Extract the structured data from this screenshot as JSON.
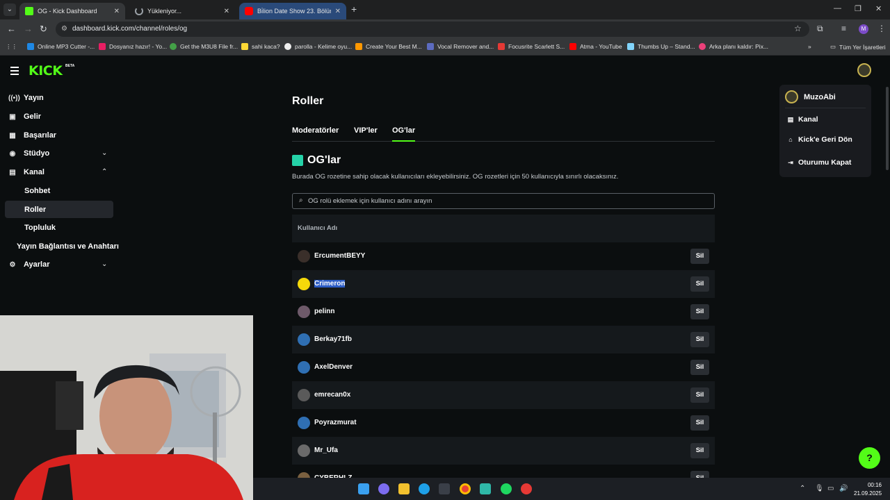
{
  "browser": {
    "tabs": [
      {
        "title": "OG - Kick Dashboard",
        "favicon_color": "#53fc18"
      },
      {
        "title": "Yükleniyor...",
        "favicon_color": "#5f6368"
      },
      {
        "title": "Bi̇lion Date Show 23. Bölüm - Y",
        "favicon_color": "#ff0000"
      }
    ],
    "url": "dashboard.kick.com/channel/roles/og",
    "profile_initial": "M",
    "bookmarks": [
      {
        "label": "Online MP3 Cutter -...",
        "color": "#1e88e5"
      },
      {
        "label": "Dosyanız hazır! - Yo...",
        "color": "#e91e63"
      },
      {
        "label": "Get the M3U8 File fr...",
        "color": "#43a047"
      },
      {
        "label": "sahi kaca?",
        "color": "#fdd835"
      },
      {
        "label": "parolla - Kelime oyu...",
        "color": "#eeeeee"
      },
      {
        "label": "Create Your Best M...",
        "color": "#ff9800"
      },
      {
        "label": "Vocal Remover and...",
        "color": "#5c6bc0"
      },
      {
        "label": "Focusrite Scarlett S...",
        "color": "#e53935"
      },
      {
        "label": "Atma - YouTube",
        "color": "#ff0000"
      },
      {
        "label": "Thumbs Up – Stand...",
        "color": "#81d4fa"
      },
      {
        "label": "Arka planı kaldır: Pix...",
        "color": "#ec407a"
      }
    ],
    "all_bookmarks_label": "Tüm Yer İşaretleri"
  },
  "app": {
    "logo": "KICK",
    "beta": "BETA",
    "sidebar": {
      "items": [
        {
          "label": "Yayın",
          "icon": "broadcast-icon"
        },
        {
          "label": "Gelir",
          "icon": "wallet-icon"
        },
        {
          "label": "Başarılar",
          "icon": "trophy-icon"
        },
        {
          "label": "Stüdyo",
          "icon": "studio-icon"
        },
        {
          "label": "Kanal",
          "icon": "channel-icon"
        }
      ],
      "sub_items": [
        "Sohbet",
        "Roller",
        "Topluluk"
      ],
      "stream_key": "Yayın Bağlantısı ve Anahtarı",
      "settings": "Ayarlar"
    },
    "page_title": "Roller",
    "tabs": [
      "Moderatörler",
      "VIP'ler",
      "OG'lar"
    ],
    "active_tab": "OG'lar",
    "section_title": "OG'lar",
    "description": "Burada OG rozetine sahip olacak kullanıcıları ekleyebilirsiniz. OG rozetleri için 50 kullanıcıyla sınırlı olacaksınız.",
    "search_placeholder": "OG rolü eklemek için kullanıcı adını arayın",
    "table_header": "Kullanıcı Adı",
    "delete_label": "Sil",
    "users": [
      {
        "name": "ErcumentBEYY",
        "avatar_color": "#3a2f2a"
      },
      {
        "name": "Crimeron",
        "avatar_color": "#f5d90a"
      },
      {
        "name": "pelinn",
        "avatar_color": "#6e5a6a"
      },
      {
        "name": "Berkay71fb",
        "avatar_color": "#2f6fb3"
      },
      {
        "name": "AxelDenver",
        "avatar_color": "#2f6fb3"
      },
      {
        "name": "emrecan0x",
        "avatar_color": "#5a5a5a"
      },
      {
        "name": "Poyrazmurat",
        "avatar_color": "#2f6fb3"
      },
      {
        "name": "Mr_Ufa",
        "avatar_color": "#6a6a6a"
      },
      {
        "name": "CYBERHLZ",
        "avatar_color": "#7a6040"
      }
    ],
    "menu": {
      "username": "MuzoAbi",
      "items": [
        {
          "label": "Kanal",
          "icon": "channel-icon"
        },
        {
          "label": "Kick'e Geri Dön",
          "icon": "home-icon"
        },
        {
          "label": "Oturumu Kapat",
          "icon": "logout-icon"
        }
      ]
    }
  },
  "taskbar": {
    "time": "00:16",
    "date": "21.09.2025"
  }
}
